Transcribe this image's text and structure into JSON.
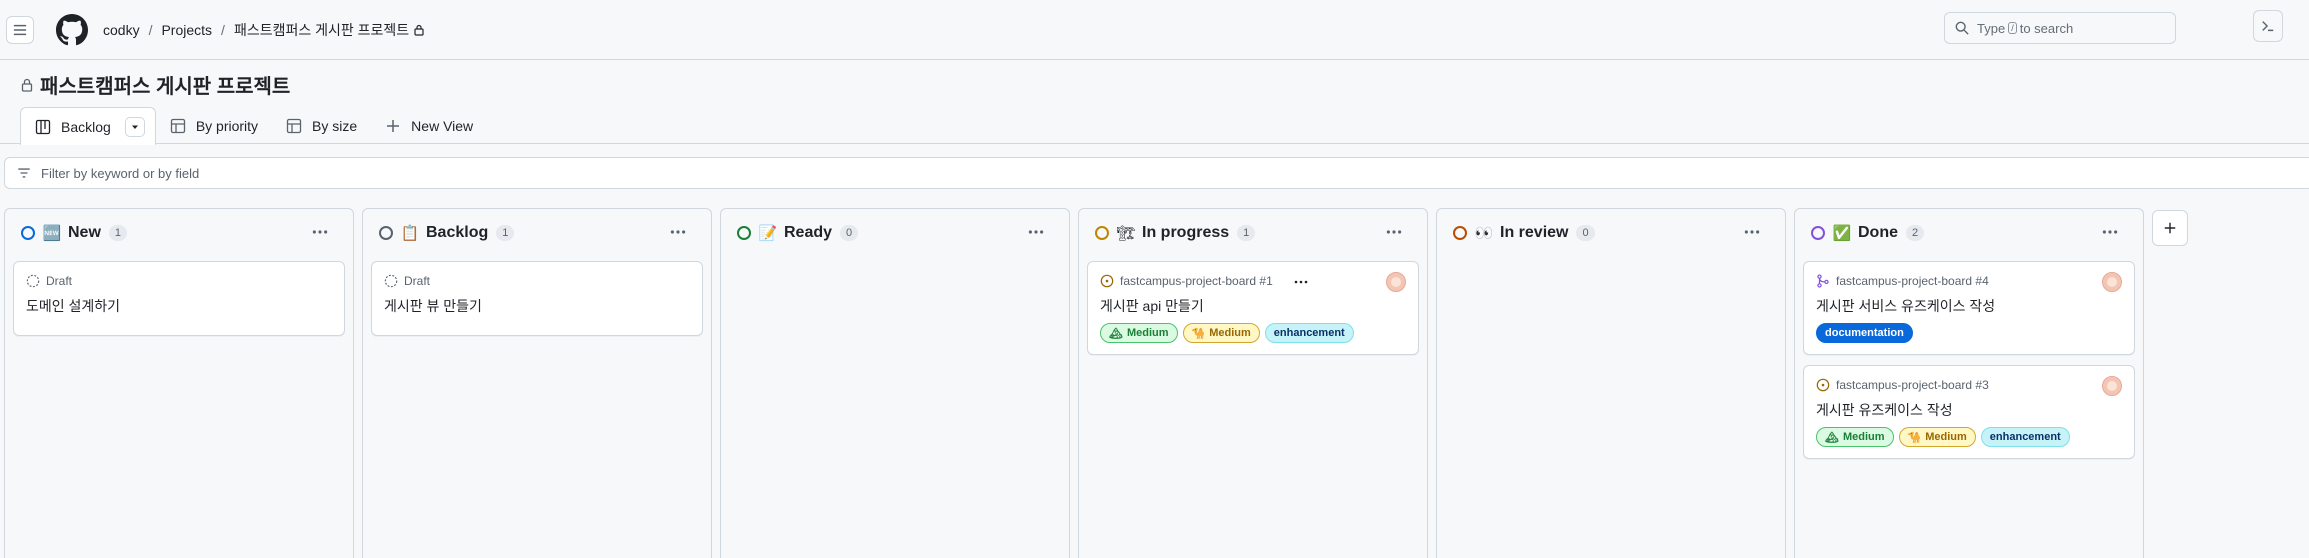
{
  "breadcrumb": {
    "owner": "codky",
    "section": "Projects",
    "project": "패스트캠퍼스 게시판 프로젝트"
  },
  "search": {
    "prefix": "Type",
    "key": "/",
    "suffix": "to search"
  },
  "project": {
    "title": "패스트캠퍼스 게시판 프로젝트"
  },
  "views": [
    {
      "label": "Backlog",
      "icon": "board-icon",
      "active": true
    },
    {
      "label": "By priority",
      "icon": "table-icon"
    },
    {
      "label": "By size",
      "icon": "table-icon"
    },
    {
      "label": "New View",
      "icon": "plus-icon"
    }
  ],
  "filter": {
    "placeholder": "Filter by keyword or by field"
  },
  "columns": [
    {
      "name": "New",
      "emoji": "🆕",
      "count": "1",
      "ring": "#0969da",
      "cards": [
        {
          "meta": "Draft",
          "title": "도메인 설계하기"
        }
      ]
    },
    {
      "name": "Backlog",
      "emoji": "📋",
      "count": "1",
      "ring": "#59636e",
      "cards": [
        {
          "meta": "Draft",
          "title": "게시판 뷰 만들기"
        }
      ]
    },
    {
      "name": "Ready",
      "emoji": "📝",
      "count": "0",
      "ring": "#1a7f37",
      "cards": []
    },
    {
      "name": "In progress",
      "emoji": "🏗",
      "count": "1",
      "ring": "#bf8700",
      "cards": [
        {
          "meta": "fastcampus-project-board #1",
          "title": "게시판 api 만들기",
          "labels": [
            {
              "emoji": "🏔",
              "text": "Medium"
            },
            {
              "emoji": "🐪",
              "text": "Medium"
            },
            {
              "text": "enhancement"
            }
          ]
        }
      ]
    },
    {
      "name": "In review",
      "emoji": "👀",
      "count": "0",
      "ring": "#bc4c00",
      "cards": []
    },
    {
      "name": "Done",
      "emoji": "✅",
      "count": "2",
      "ring": "#8250df",
      "cards": [
        {
          "meta": "fastcampus-project-board #4",
          "title": "게시판 서비스 유즈케이스 작성",
          "labels": [
            {
              "text": "documentation"
            }
          ]
        },
        {
          "meta": "fastcampus-project-board #3",
          "title": "게시판 유즈케이스 작성",
          "labels": [
            {
              "emoji": "🏔",
              "text": "Medium"
            },
            {
              "emoji": "🐪",
              "text": "Medium"
            },
            {
              "text": "enhancement"
            }
          ]
        }
      ]
    }
  ],
  "icons": {
    "lock": "lock-icon",
    "search": "search-icon",
    "command": "command-palette-icon",
    "filter": "filter-icon",
    "kebab": "kebab-horizontal-icon",
    "add": "plus-icon"
  }
}
